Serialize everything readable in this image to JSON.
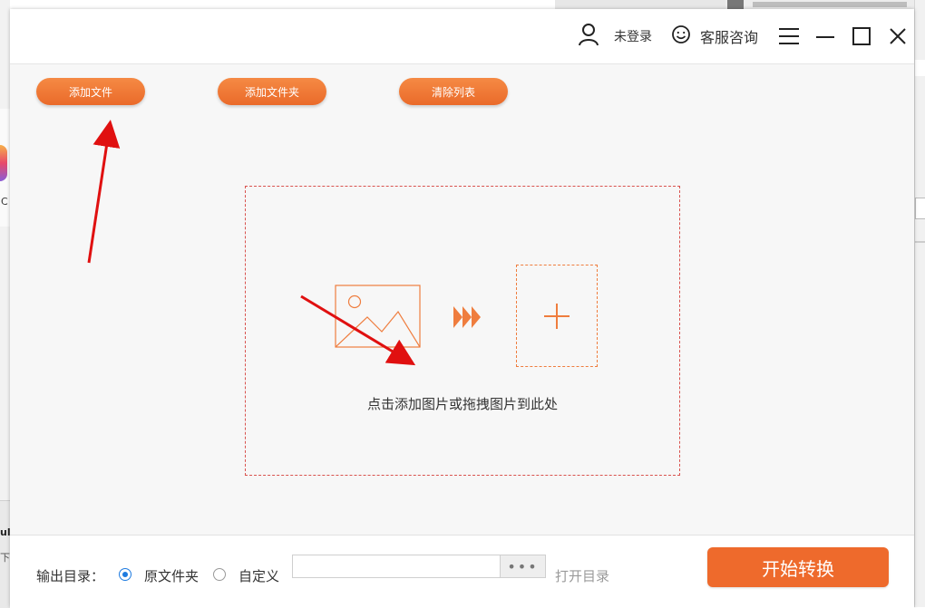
{
  "titlebar": {
    "user_label": "未登录",
    "service_label": "客服咨询"
  },
  "toolbar": {
    "add_file": "添加文件",
    "add_folder": "添加文件夹",
    "clear_list": "清除列表"
  },
  "dropzone": {
    "hint": "点击添加图片或拖拽图片到此处"
  },
  "output": {
    "label": "输出目录：",
    "option_original": "原文件夹",
    "option_custom": "自定义",
    "selected": "原文件夹",
    "path_value": "",
    "browse_label": "•••",
    "open_dir": "打开目录",
    "start": "开始转换"
  },
  "background": {
    "left_fragment_text": "C",
    "left_fragment_bold": "ul",
    "left_fragment_small": "下"
  },
  "colors": {
    "accent": "#ee6a2c",
    "dashed_border": "#d9534f",
    "radio_selected": "#1e7be0",
    "annotation_arrow": "#e01010"
  }
}
